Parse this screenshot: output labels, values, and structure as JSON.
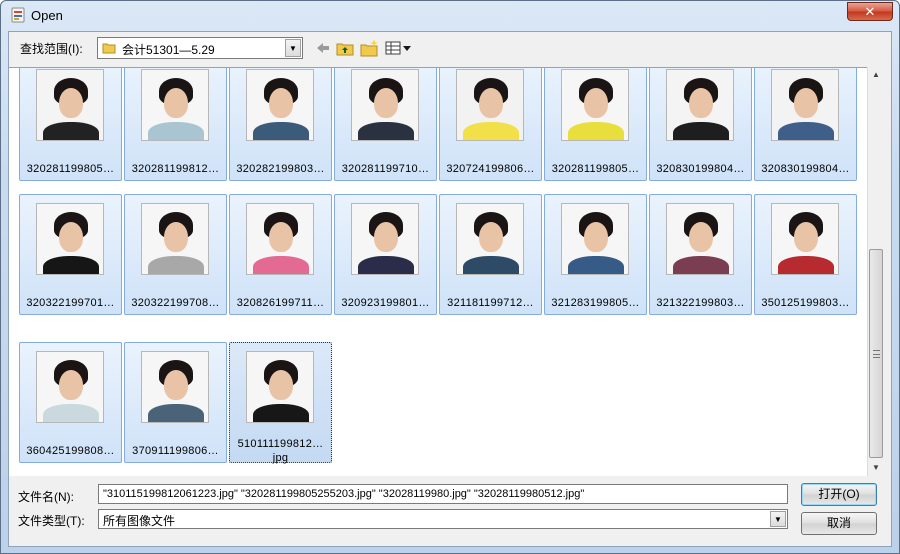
{
  "window": {
    "title": "Open",
    "close_label": "✕"
  },
  "toolbar": {
    "look_in_label": "查找范围(I):",
    "look_in_value": "会计51301—5.29"
  },
  "files": [
    {
      "label": "320281199805…",
      "bg": "#f4f4f4",
      "body": "#222222",
      "row": 0,
      "col": 0
    },
    {
      "label": "320281199812…",
      "bg": "#f6f6f6",
      "body": "#a9c5d2",
      "row": 0,
      "col": 1
    },
    {
      "label": "320282199803…",
      "bg": "#f6f6f6",
      "body": "#3c5a7a",
      "row": 0,
      "col": 2
    },
    {
      "label": "320281199710…",
      "bg": "#f5f5f5",
      "body": "#2a3140",
      "row": 0,
      "col": 3
    },
    {
      "label": "320724199806…",
      "bg": "#f2f2f2",
      "body": "#f2e04a",
      "row": 0,
      "col": 4
    },
    {
      "label": "320281199805…",
      "bg": "#f6f6f6",
      "body": "#e8df3c",
      "row": 0,
      "col": 5
    },
    {
      "label": "320830199804…",
      "bg": "#f4f4f4",
      "body": "#1e1e1e",
      "row": 0,
      "col": 6
    },
    {
      "label": "320830199804…",
      "bg": "#f3f3f3",
      "body": "#3f5f8a",
      "row": 0,
      "col": 7
    },
    {
      "label": "320322199701…",
      "bg": "#f6f6f6",
      "body": "#161616",
      "row": 1,
      "col": 0
    },
    {
      "label": "320322199708…",
      "bg": "#f6f6f6",
      "body": "#a8a8a8",
      "row": 1,
      "col": 1
    },
    {
      "label": "320826199711…",
      "bg": "#f6f6f6",
      "body": "#e36a93",
      "row": 1,
      "col": 2
    },
    {
      "label": "320923199801…",
      "bg": "#f6f6f6",
      "body": "#2b2c4a",
      "row": 1,
      "col": 3
    },
    {
      "label": "321181199712…",
      "bg": "#f6f6f6",
      "body": "#2d4a66",
      "row": 1,
      "col": 4
    },
    {
      "label": "321283199805…",
      "bg": "#f6f6f6",
      "body": "#355b86",
      "row": 1,
      "col": 5
    },
    {
      "label": "321322199803…",
      "bg": "#f6f6f6",
      "body": "#7a3d52",
      "row": 1,
      "col": 6
    },
    {
      "label": "350125199803…",
      "bg": "#f6f6f6",
      "body": "#b72a2f",
      "row": 1,
      "col": 7
    },
    {
      "label": "360425199808…",
      "bg": "#f6f6f6",
      "body": "#c9d9de",
      "row": 2,
      "col": 0
    },
    {
      "label": "370911199806…",
      "bg": "#f6f6f6",
      "body": "#4a6379",
      "row": 2,
      "col": 1
    },
    {
      "label": "510111199812…jpg",
      "bg": "#f6f6f6",
      "body": "#171717",
      "row": 2,
      "col": 2,
      "focused": true
    }
  ],
  "filename": {
    "label": "文件名(N):",
    "value": "\"310115199812061223.jpg\" \"320281199805255203.jpg\" \"32028119980.jpg\" \"32028119980512.jpg\""
  },
  "filetype": {
    "label": "文件类型(T):",
    "value": "所有图像文件"
  },
  "buttons": {
    "open": "打开(O)",
    "cancel": "取消"
  }
}
